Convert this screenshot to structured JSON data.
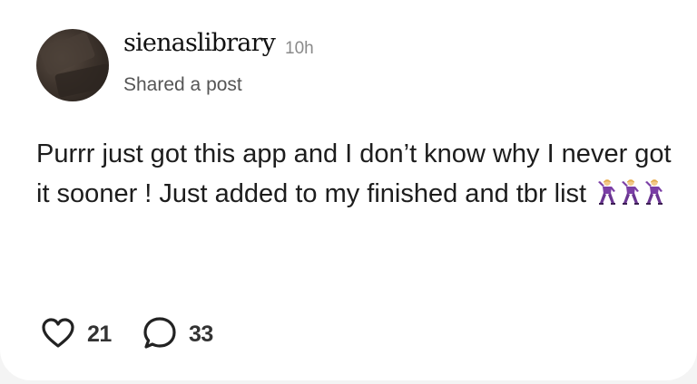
{
  "post": {
    "username": "sienaslibrary",
    "time": "10h",
    "subtitle": "Shared a post",
    "body_text": "Purrr just got this app and I don’t know why I never got it sooner ! Just added to my finished and tbr list",
    "emoji_name": "man-dancing-emoji",
    "emoji_count": 3
  },
  "actions": {
    "likes": "21",
    "comments": "33",
    "like_icon": "heart-icon",
    "comment_icon": "speech-bubble-icon"
  },
  "colors": {
    "background": "#ffffff",
    "text": "#1d1d1d",
    "muted": "#8a8a8a",
    "emoji_purple": "#7b3fa6"
  }
}
